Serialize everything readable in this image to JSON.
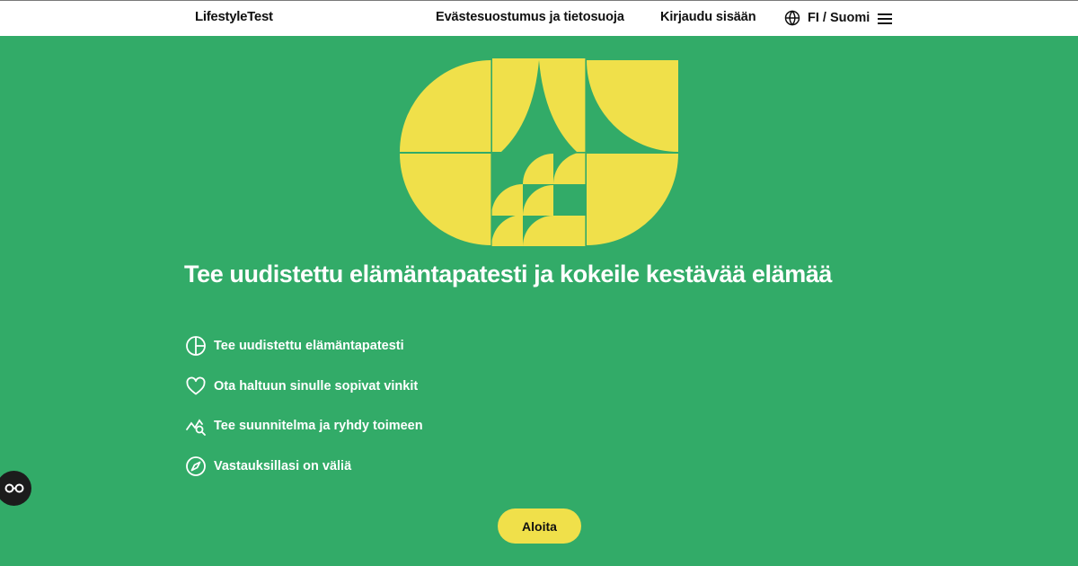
{
  "header": {
    "logo": "LifestyleTest",
    "nav": {
      "cookie_label": "Evästesuostumus ja tietosuoja",
      "login_label": "Kirjaudu sisään",
      "language_label": "FI / Suomi"
    },
    "icons": {
      "language": "globe-icon",
      "menu": "hamburger-menu-icon"
    }
  },
  "hero": {
    "illustration": "yellow-geometric-shapes-illustration",
    "title": "Tee uudistettu elämäntapatesti ja kokeile kestävää elämää",
    "features": [
      {
        "icon": "pie-chart-icon",
        "text": "Tee uudistettu elämäntapatesti"
      },
      {
        "icon": "heart-icon",
        "text": "Ota haltuun sinulle sopivat vinkit"
      },
      {
        "icon": "trend-search-icon",
        "text": "Tee suunnitelma ja ryhdy toimeen"
      },
      {
        "icon": "compass-icon",
        "text": "Vastauksillasi on väliä"
      }
    ],
    "start_button": "Aloita"
  },
  "accessibility_button": {
    "icon": "accessibility-glasses-icon"
  },
  "colors": {
    "background": "#32ab68",
    "accent_yellow": "#f0e04a",
    "header_bg": "#ffffff",
    "text_dark": "#111111",
    "text_light": "#ffffff"
  }
}
